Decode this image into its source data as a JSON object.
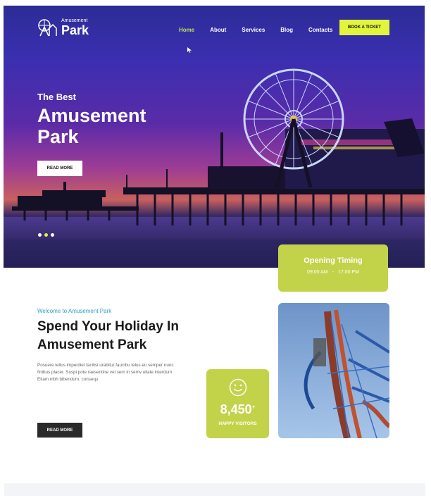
{
  "header": {
    "logo_small": "Amusement",
    "logo_big": "Park",
    "nav": [
      {
        "label": "Home",
        "active": true
      },
      {
        "label": "About",
        "active": false
      },
      {
        "label": "Services",
        "active": false
      },
      {
        "label": "Blog",
        "active": false
      },
      {
        "label": "Contacts",
        "active": false
      }
    ],
    "cta_label": "BOOK A TICKET"
  },
  "hero": {
    "subtitle": "The Best",
    "title": "Amusement Park",
    "button_label": "READ MORE",
    "slider_dots": 3,
    "active_dot": 1
  },
  "opening": {
    "title": "Opening Timing",
    "open_time": "09:00 AM",
    "separator": "-",
    "close_time": "17:00 PM"
  },
  "about": {
    "eyebrow": "Welcome to Amusement Park",
    "heading": "Spend Your Holiday In Amusement Park",
    "body": "Posuere tellus imperdiet facilisi urabitur faucibu telus eu semper nunc finibus placer. Suspi pote raesentine vel sem in semv ullate interdum Etiam nibh bibendum, consequ",
    "button_label": "READ MORE"
  },
  "stats": {
    "value": "8,450",
    "suffix": "+",
    "label": "HAPPY VISITORS"
  },
  "colors": {
    "accent": "#e1f53a",
    "card": "#c2d34a",
    "link": "#2fa0c9",
    "dark": "#2a2a2a"
  },
  "icons": [
    "park-logo-icon",
    "smile-icon",
    "cursor-icon"
  ]
}
